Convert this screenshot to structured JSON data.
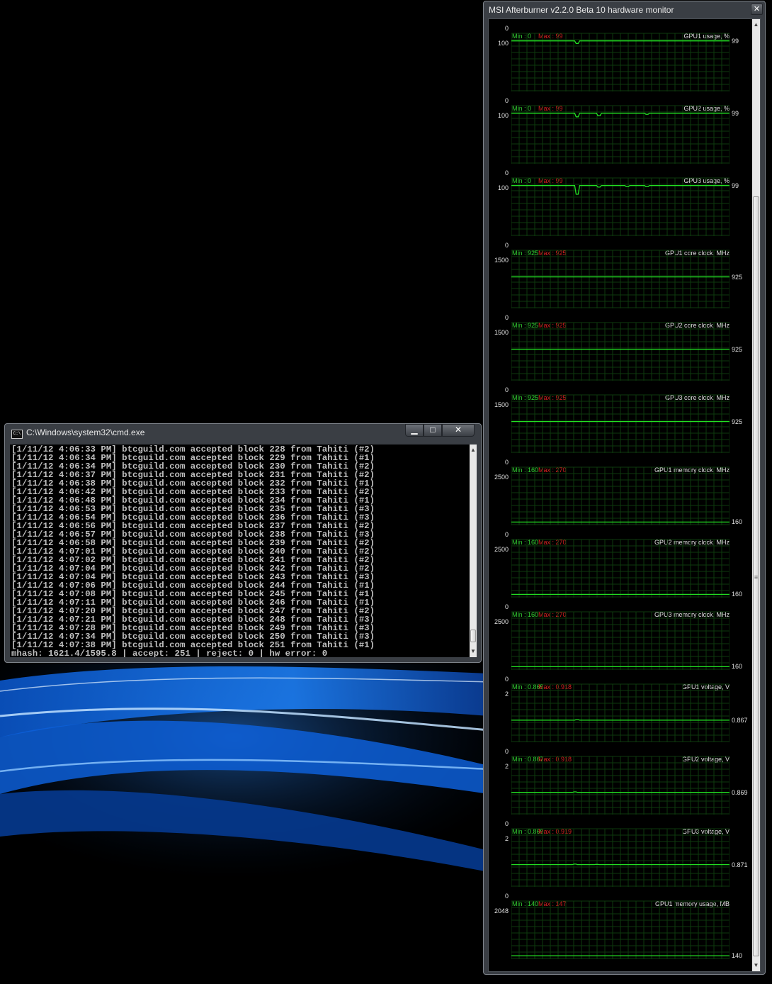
{
  "desktop": {
    "accent": "#1a6ad8"
  },
  "cmd": {
    "title": "C:\\Windows\\system32\\cmd.exe",
    "icon": "console-icon",
    "buttons": {
      "minimize": "▁",
      "maximize": "□",
      "close": "✕"
    },
    "lines": [
      "[1/11/12 4:06:33 PM] btcguild.com accepted block 228 from Tahiti (#2)",
      "[1/11/12 4:06:34 PM] btcguild.com accepted block 229 from Tahiti (#1)",
      "[1/11/12 4:06:34 PM] btcguild.com accepted block 230 from Tahiti (#2)",
      "[1/11/12 4:06:37 PM] btcguild.com accepted block 231 from Tahiti (#2)",
      "[1/11/12 4:06:38 PM] btcguild.com accepted block 232 from Tahiti (#1)",
      "[1/11/12 4:06:42 PM] btcguild.com accepted block 233 from Tahiti (#2)",
      "[1/11/12 4:06:48 PM] btcguild.com accepted block 234 from Tahiti (#1)",
      "[1/11/12 4:06:53 PM] btcguild.com accepted block 235 from Tahiti (#3)",
      "[1/11/12 4:06:54 PM] btcguild.com accepted block 236 from Tahiti (#3)",
      "[1/11/12 4:06:56 PM] btcguild.com accepted block 237 from Tahiti (#2)",
      "[1/11/12 4:06:57 PM] btcguild.com accepted block 238 from Tahiti (#3)",
      "[1/11/12 4:06:58 PM] btcguild.com accepted block 239 from Tahiti (#2)",
      "[1/11/12 4:07:01 PM] btcguild.com accepted block 240 from Tahiti (#2)",
      "[1/11/12 4:07:02 PM] btcguild.com accepted block 241 from Tahiti (#2)",
      "[1/11/12 4:07:04 PM] btcguild.com accepted block 242 from Tahiti (#2)",
      "[1/11/12 4:07:04 PM] btcguild.com accepted block 243 from Tahiti (#3)",
      "[1/11/12 4:07:06 PM] btcguild.com accepted block 244 from Tahiti (#1)",
      "[1/11/12 4:07:08 PM] btcguild.com accepted block 245 from Tahiti (#1)",
      "[1/11/12 4:07:11 PM] btcguild.com accepted block 246 from Tahiti (#1)",
      "[1/11/12 4:07:20 PM] btcguild.com accepted block 247 from Tahiti (#2)",
      "[1/11/12 4:07:21 PM] btcguild.com accepted block 248 from Tahiti (#3)",
      "[1/11/12 4:07:28 PM] btcguild.com accepted block 249 from Tahiti (#3)",
      "[1/11/12 4:07:34 PM] btcguild.com accepted block 250 from Tahiti (#3)",
      "[1/11/12 4:07:38 PM] btcguild.com accepted block 251 from Tahiti (#1)",
      "mhash: 1621.4/1595.8 | accept: 251 | reject: 0 | hw error: 0"
    ],
    "scrollbar": {
      "up": "▲",
      "down": "▼",
      "position": 0.98
    }
  },
  "afterburner": {
    "title": "MSI Afterburner v2.2.0 Beta 10 hardware monitor",
    "buttons": {
      "close": "✕"
    },
    "scrollbar": {
      "up": "▲",
      "down": "▼",
      "grip": "≡"
    },
    "colors": {
      "line": "#22e022",
      "grid": "#0e3a0e",
      "min": "#33d433",
      "max": "#d42020"
    },
    "graphs": [
      {
        "name": "GPU1 usage, %",
        "min": "Min : 0",
        "max": "Max : 99",
        "scale_max": "100",
        "scale_min": "0",
        "current": "99",
        "baseline": 99,
        "limit": 100,
        "dips": [
          [
            0.3,
            -5
          ]
        ]
      },
      {
        "name": "GPU2 usage, %",
        "min": "Min : 0",
        "max": "Max : 99",
        "scale_max": "100",
        "scale_min": "0",
        "current": "99",
        "baseline": 99,
        "limit": 100,
        "dips": [
          [
            0.3,
            -7
          ],
          [
            0.4,
            -5
          ],
          [
            0.62,
            -2
          ]
        ]
      },
      {
        "name": "GPU3 usage, %",
        "min": "Min : 0",
        "max": "Max : 99",
        "scale_max": "100",
        "scale_min": "0",
        "current": "99",
        "baseline": 99,
        "limit": 100,
        "dips": [
          [
            0.3,
            -17
          ],
          [
            0.4,
            -3
          ],
          [
            0.53,
            -2
          ],
          [
            0.62,
            -2
          ]
        ]
      },
      {
        "name": "GPU1 core clock, MHz",
        "min": "Min : 925",
        "max": "Max : 925",
        "scale_max": "1500",
        "scale_min": "0",
        "current": "925",
        "baseline": 925,
        "limit": 1500,
        "dips": []
      },
      {
        "name": "GPU2 core clock, MHz",
        "min": "Min : 925",
        "max": "Max : 925",
        "scale_max": "1500",
        "scale_min": "0",
        "current": "925",
        "baseline": 925,
        "limit": 1500,
        "dips": []
      },
      {
        "name": "GPU3 core clock, MHz",
        "min": "Min : 925",
        "max": "Max : 925",
        "scale_max": "1500",
        "scale_min": "0",
        "current": "925",
        "baseline": 925,
        "limit": 1500,
        "dips": []
      },
      {
        "name": "GPU1 memory clock, MHz",
        "min": "Min : 160",
        "max": "Max : 270",
        "scale_max": "2500",
        "scale_min": "0",
        "current": "160",
        "baseline": 160,
        "limit": 2500,
        "dips": []
      },
      {
        "name": "GPU2 memory clock, MHz",
        "min": "Min : 160",
        "max": "Max : 270",
        "scale_max": "2500",
        "scale_min": "0",
        "current": "160",
        "baseline": 160,
        "limit": 2500,
        "dips": []
      },
      {
        "name": "GPU3 memory clock, MHz",
        "min": "Min : 160",
        "max": "Max : 270",
        "scale_max": "2500",
        "scale_min": "0",
        "current": "160",
        "baseline": 160,
        "limit": 2500,
        "dips": []
      },
      {
        "name": "GPU1 voltage, V",
        "min": "Min : 0.865",
        "max": "Max : 0.918",
        "scale_max": "2",
        "scale_min": "0",
        "current": "0.867",
        "baseline": 0.867,
        "limit": 2,
        "dips": [
          [
            0.3,
            0.02
          ]
        ]
      },
      {
        "name": "GPU2 voltage, V",
        "min": "Min : 0.867",
        "max": "Max : 0.918",
        "scale_max": "2",
        "scale_min": "0",
        "current": "0.869",
        "baseline": 0.869,
        "limit": 2,
        "dips": [
          [
            0.29,
            0.02
          ]
        ]
      },
      {
        "name": "GPU3 voltage, V",
        "min": "Min : 0.869",
        "max": "Max : 0.919",
        "scale_max": "2",
        "scale_min": "0",
        "current": "0.871",
        "baseline": 0.871,
        "limit": 2,
        "dips": [
          [
            0.29,
            0.02
          ],
          [
            0.39,
            0.01
          ]
        ]
      },
      {
        "name": "GPU1 memory usage, MB",
        "min": "Min : 140",
        "max": "Max : 147",
        "scale_max": "2048",
        "scale_min": "0",
        "current": "140",
        "baseline": 140,
        "limit": 2048,
        "dips": []
      }
    ]
  }
}
